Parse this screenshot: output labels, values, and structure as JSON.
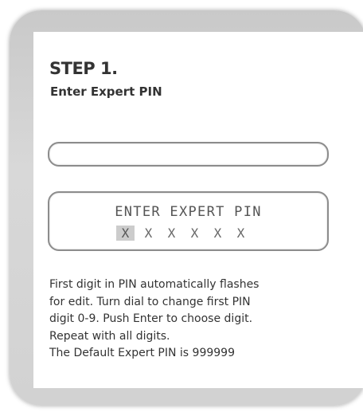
{
  "step": {
    "title": "STEP 1.",
    "subtitle": "Enter Expert PIN"
  },
  "display": {
    "line1": "ENTER EXPERT PIN",
    "pin_digits": [
      "X",
      "X",
      "X",
      "X",
      "X",
      "X"
    ],
    "active_digit_index": 0
  },
  "instructions": {
    "lines": [
      "First digit in PIN automatically flashes",
      "for edit.  Turn dial to change first PIN",
      "digit 0-9.  Push Enter to choose digit.",
      "Repeat with all digits.",
      "The Default Expert PIN is 999999"
    ]
  },
  "colors": {
    "frame": "#cfcfcf",
    "text": "#333333",
    "highlight": "#cccccc"
  }
}
